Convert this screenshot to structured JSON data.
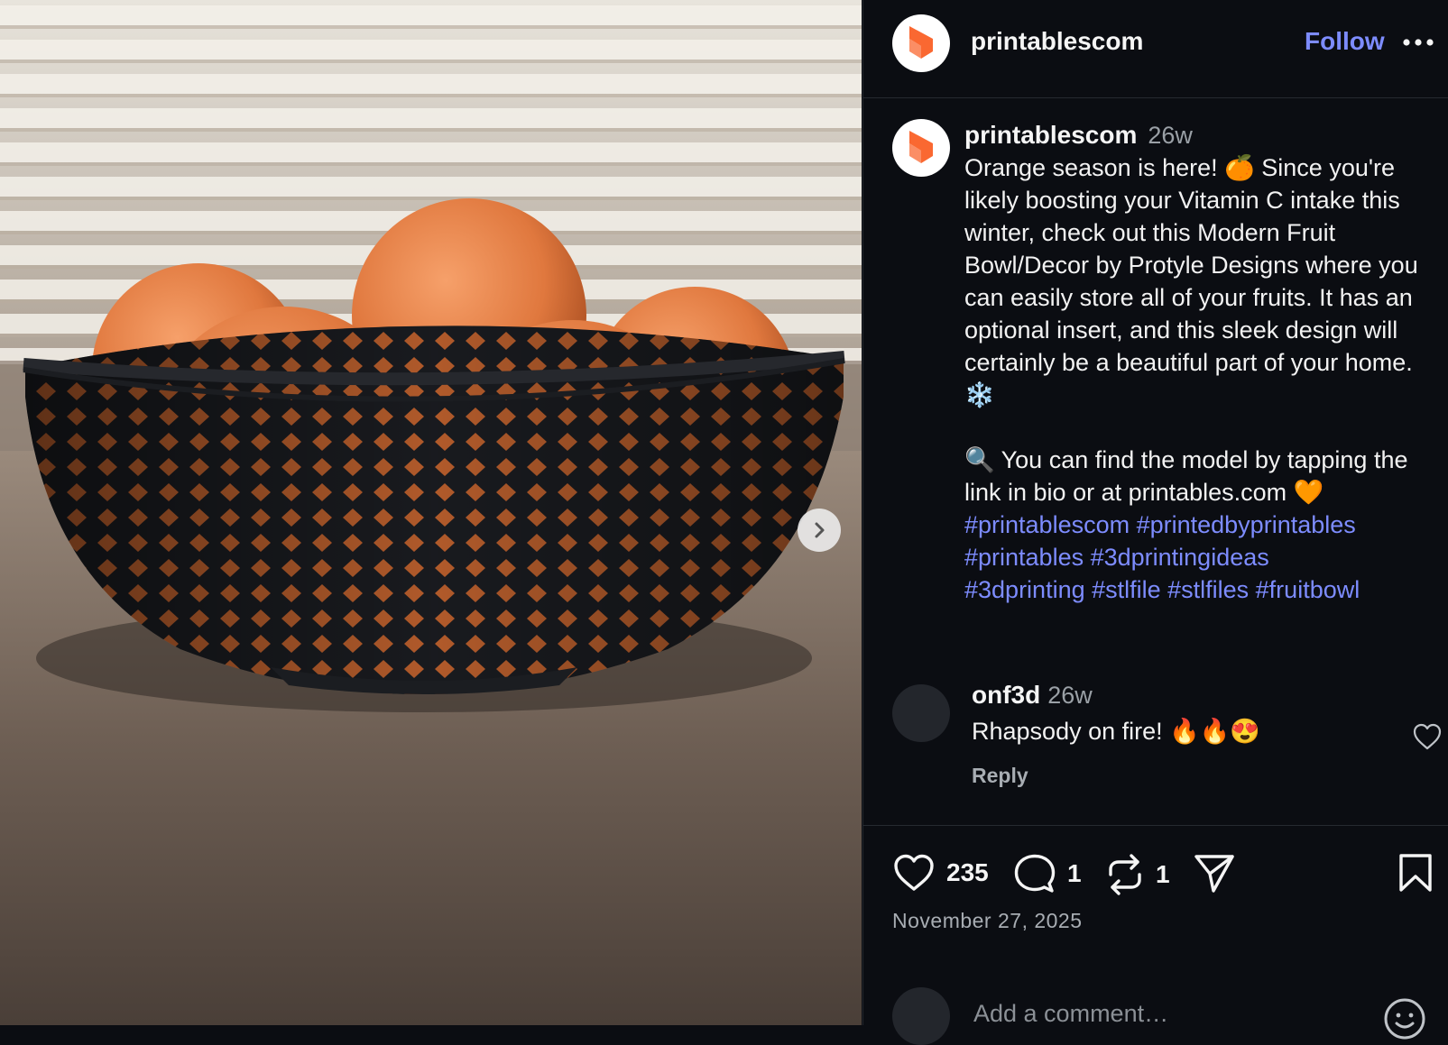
{
  "post": {
    "author": "printablescom",
    "follow_label": "Follow",
    "caption_author": "printablescom",
    "caption_time": "26w",
    "caption_text": "Orange season is here! 🍊 Since you're likely boosting your Vitamin C intake this winter, check out this Modern Fruit Bowl/Decor by Protyle Designs where you can easily store all of your fruits. It has an optional insert, and this sleek design will certainly be a beautiful part of your home. ❄️\n\n🔍 You can find the model by tapping the link in bio or at printables.com 🧡\n",
    "hashtags_line1": "#printablescom #printedbyprintables",
    "hashtags_line2": "#printables #3dprintingideas",
    "hashtags_line3": "#3dprinting #stlfile #stlfiles #fruitbowl"
  },
  "comment": {
    "user": "onf3d",
    "time": "26w",
    "text": "Rhapsody on fire! 🔥🔥😍",
    "reply_label": "Reply"
  },
  "actions": {
    "likes": "235",
    "comments": "1",
    "reposts": "1",
    "date": "November 27, 2025"
  },
  "add_comment": {
    "placeholder": "Add a comment…"
  },
  "icons": {
    "next": "chevron-right-icon",
    "more": "more-horizontal-icon",
    "like": "heart-icon",
    "comment": "comment-bubble-icon",
    "repost": "repost-icon",
    "share": "send-icon",
    "save": "bookmark-icon",
    "emoji": "emoji-icon"
  },
  "colors": {
    "accent": "#7d8cff",
    "brand": "#fa6831",
    "background": "#0b0d12"
  }
}
